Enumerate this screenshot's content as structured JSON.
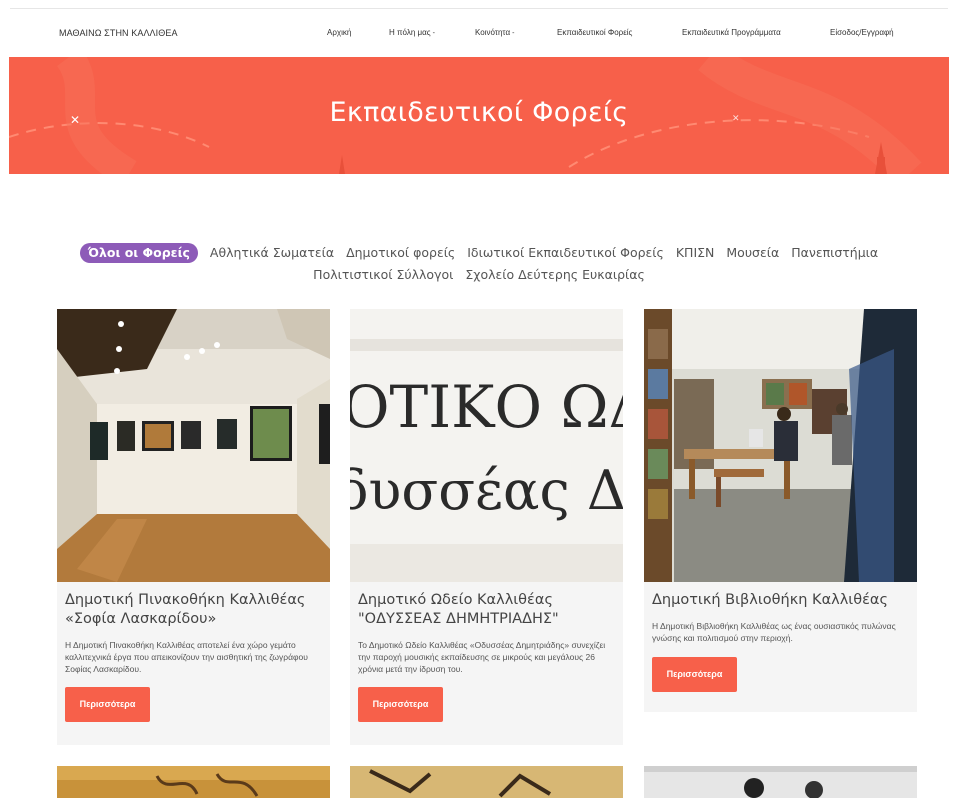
{
  "nav": {
    "brand": "ΜΑΘΑΙΝΩ ΣΤΗΝ ΚΑΛΛΙΘΕΑ",
    "items": [
      {
        "label": "Αρχική",
        "dropdown": false
      },
      {
        "label": "Η πόλη μας",
        "dropdown": true
      },
      {
        "label": "Κοινότητα",
        "dropdown": true
      },
      {
        "label": "Εκπαιδευτικοί Φορείς",
        "dropdown": false
      },
      {
        "label": "Εκπαιδευτικά Προγράμματα",
        "dropdown": false
      },
      {
        "label": "Είσοδος/Εγγραφή",
        "dropdown": false
      }
    ],
    "dropdown_caret": "-"
  },
  "hero": {
    "title": "Εκπαιδευτικοί Φορείς",
    "bg_color": "#f7604a"
  },
  "filters": {
    "active_color": "#8d5bb8",
    "row1": [
      "Όλοι οι Φορείς",
      "Αθλητικά Σωματεία",
      "Δημοτικοί φορείς",
      "Ιδιωτικοί Εκπαιδευτικοί Φορείς",
      "ΚΠΙΣΝ",
      "Μουσεία",
      "Πανεπιστήμια"
    ],
    "row2": [
      "Πολιτιστικοί Σύλλογοι",
      "Σχολείο Δεύτερης Ευκαιρίας"
    ],
    "active": "Όλοι οι Φορείς"
  },
  "cards": [
    {
      "title": "Δημοτική Πινακοθήκη Καλλιθέας «Σοφία Λασκαρίδου»",
      "description": "Η Δημοτική Πινακοθήκη Καλλιθέας αποτελεί ένα χώρο γεμάτο καλλιτεχνικά έργα που απεικονίζουν την αισθητική της ζωγράφου Σοφίας Λασκαρίδου.",
      "button": "Περισσότερα",
      "image": "art-gallery-photo"
    },
    {
      "title": "Δημοτικό Ωδείο Καλλιθέας \"ΟΔΥΣΣΕΑΣ ΔΗΜΗΤΡΙΑΔΗΣ\"",
      "description": "Το Δημοτικό Ωδείο Καλλιθέας «Οδυσσέας Δημητριάδης» συνεχίζει την παροχή μουσικής εκπαίδευσης σε μικρούς και μεγάλους 26 χρόνια μετά την ίδρυση του.",
      "button": "Περισσότερα",
      "image": "conservatory-sign-photo",
      "image_text": [
        "ΟΤΙΚΟ ΩΔΕΙΟ",
        "δυσσέας Δημ"
      ]
    },
    {
      "title": "Δημοτική Βιβλιοθήκη Καλλιθέας",
      "description": "Η Δημοτική Βιβλιοθήκη Καλλιθέας ως ένας ουσιαστικός πυλώνας γνώσης και πολιτισμού στην περιοχή.",
      "button": "Περισσότερα",
      "image": "library-photo"
    }
  ],
  "accent": "#f7604a"
}
